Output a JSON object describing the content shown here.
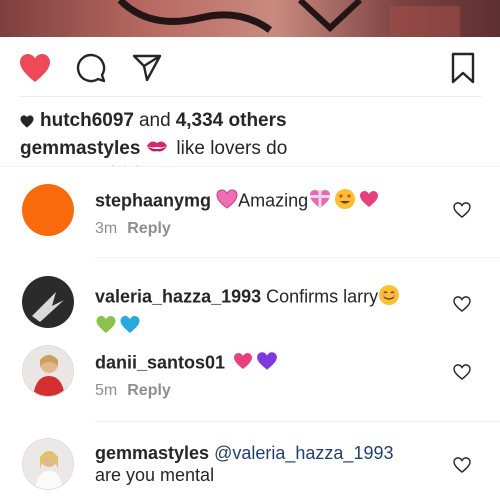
{
  "post": {
    "liked_by_user": "hutch6097",
    "likes_suffix": "and",
    "likes_count": "4,334 others",
    "caption_user": "gemmastyles",
    "caption_text": "like lovers do"
  },
  "actions": {
    "like": "heart-filled-icon",
    "comment": "comment-icon",
    "share": "send-icon",
    "save": "bookmark-icon",
    "like_color": "#ed4956"
  },
  "comments": [
    {
      "user": "stephaanymg",
      "text": "Amazing",
      "time": "3m",
      "reply": "Reply",
      "avatar_color": "#f96a0c"
    },
    {
      "user": "valeria_hazza_1993",
      "text": "Confirms larry"
    },
    {
      "user": "danii_santos01",
      "text": "",
      "time": "5m",
      "reply": "Reply"
    },
    {
      "user": "gemmastyles",
      "mention": "@valeria_hazza_1993",
      "text": "are you mental"
    }
  ]
}
